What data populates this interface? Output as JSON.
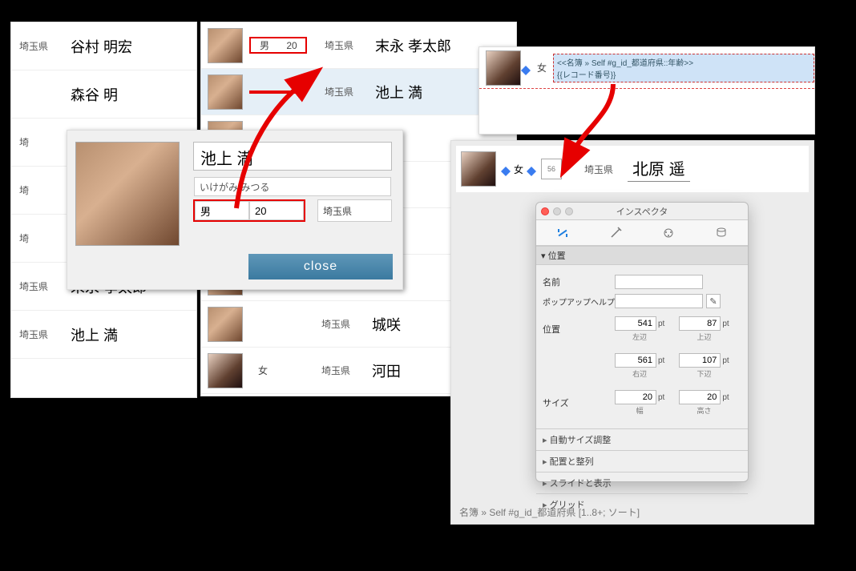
{
  "left_list": [
    {
      "pref": "埼玉県",
      "name": "谷村 明宏"
    },
    {
      "pref": "",
      "name": "森谷 明"
    },
    {
      "pref": "埼",
      "name": ""
    },
    {
      "pref": "埼",
      "name": ""
    },
    {
      "pref": "埼",
      "name": ""
    },
    {
      "pref": "埼玉県",
      "name": "末永 孝太郎"
    },
    {
      "pref": "埼玉県",
      "name": "池上 満"
    }
  ],
  "mid_list": [
    {
      "sex": "男",
      "age": "20",
      "pref": "埼玉県",
      "name": "末永 孝太郎",
      "hl": true,
      "sel": false
    },
    {
      "sex": "",
      "age": "",
      "pref": "埼玉県",
      "name": "池上 満",
      "hl": true,
      "sel": true
    },
    {
      "sex": "",
      "age": "",
      "pref": "",
      "name": "",
      "hl": false,
      "sel": false
    },
    {
      "sex": "",
      "age": "",
      "pref": "",
      "name": "",
      "hl": false,
      "sel": false
    },
    {
      "sex": "",
      "age": "",
      "pref": "",
      "name": "",
      "hl": false,
      "sel": false
    },
    {
      "sex": "",
      "age": "",
      "pref": "",
      "name": "",
      "hl": false,
      "sel": false
    },
    {
      "sex": "",
      "age": "",
      "pref": "埼玉県",
      "name": "城咲",
      "hl": false,
      "sel": false
    },
    {
      "sex": "女",
      "age": "",
      "pref": "埼玉県",
      "name": "河田",
      "hl": false,
      "sel": false
    }
  ],
  "popup": {
    "name": "池上 満",
    "kana": "いけがみ みつる",
    "sex": "男",
    "age": "20",
    "pref": "埼玉県",
    "close_label": "close"
  },
  "layout_field": {
    "sex": "女",
    "line1": "<<名簿 » Self #g_id_都道府県::年齢>>",
    "line2": "{{レコード番号}}"
  },
  "browse_record": {
    "sex": "女",
    "chip": "56",
    "pref": "埼玉県",
    "name": "北原 遥"
  },
  "inspector": {
    "title": "インスペクタ",
    "section_position": "位置",
    "label_name": "名前",
    "value_name": "",
    "label_popup": "ポップアップヘルプ",
    "value_popup": "",
    "label_pos": "位置",
    "left": "541",
    "top": "87",
    "right": "561",
    "bottom": "107",
    "sub_left": "左辺",
    "sub_top": "上辺",
    "sub_right": "右辺",
    "sub_bottom": "下辺",
    "label_size": "サイズ",
    "width": "20",
    "height": "20",
    "sub_w": "幅",
    "sub_h": "高さ",
    "unit": "pt",
    "acc_autosize": "自動サイズ調整",
    "acc_arrange": "配置と整列",
    "acc_slide": "スライドと表示",
    "acc_grid": "グリッド"
  },
  "footer_path": "名簿 » Self #g_id_都道府県 [1..8+; ソート]"
}
